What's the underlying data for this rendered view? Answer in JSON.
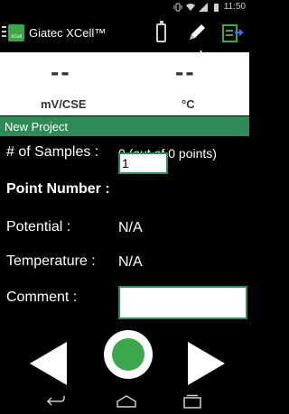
{
  "status_bar": {
    "time": "11:50",
    "icons": [
      "vibrate-icon",
      "wifi-icon",
      "cell-signal-icon",
      "battery-icon"
    ]
  },
  "app_bar": {
    "logo_text": "XCell",
    "title": "Giatec XCell™",
    "icons": [
      "menu-icon",
      "battery-icon",
      "pencil-icon",
      "export-icon"
    ]
  },
  "readings": {
    "potential_value": "--",
    "potential_unit": "mV/CSE",
    "temperature_value": "--",
    "temperature_unit": "°C"
  },
  "project": {
    "name": "New Project"
  },
  "form": {
    "samples_label": "# of Samples :",
    "samples_value": "0 (out of 0 points)",
    "point_number_label": "Point Number :",
    "point_number_value": "1",
    "potential_label": "Potential :",
    "potential_value": "N/A",
    "temperature_label": "Temperature :",
    "temperature_value": "N/A",
    "comment_label": "Comment :",
    "comment_value": ""
  },
  "controls": {
    "icons": [
      "previous-icon",
      "record-icon",
      "next-icon"
    ]
  },
  "navigation": {
    "icons": [
      "back-icon",
      "home-icon",
      "recent-apps-icon"
    ]
  },
  "colors": {
    "accent_green": "#2e8b57",
    "record_green": "#3aa74a",
    "background": "#000000",
    "readout_background": "#ffffff"
  }
}
